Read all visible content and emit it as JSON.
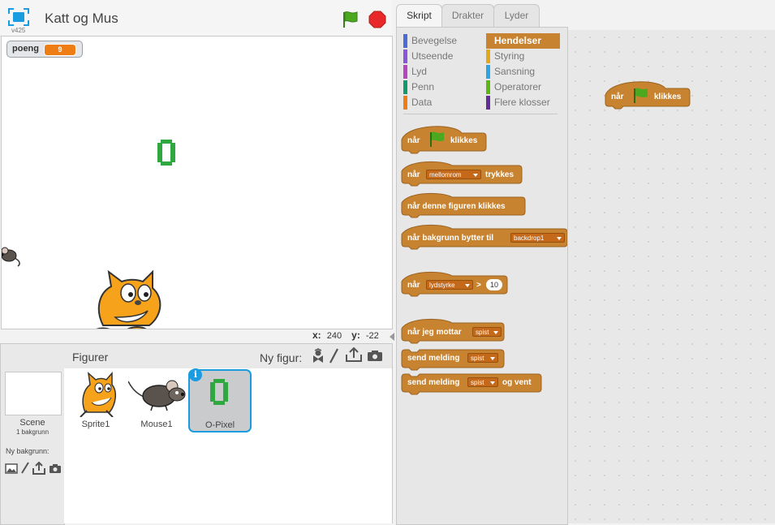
{
  "stage": {
    "version": "v425",
    "title": "Katt og Mus",
    "variable_monitor": {
      "name": "poeng",
      "value": "9"
    },
    "x_label": "x:",
    "x_value": "240",
    "y_label": "y:",
    "y_value": "-22"
  },
  "sprites_pane": {
    "scene_label": "Scene",
    "scene_backdrops": "1 bakgrunn",
    "new_backdrop_label": "Ny bakgrunn:",
    "title": "Figurer",
    "new_sprite_label": "Ny figur:",
    "sprites": [
      {
        "name": "Sprite1"
      },
      {
        "name": "Mouse1"
      },
      {
        "name": "O-Pixel",
        "selected": true
      }
    ],
    "info_badge": "i"
  },
  "tabs": [
    {
      "label": "Skript",
      "active": true
    },
    {
      "label": "Drakter",
      "active": false
    },
    {
      "label": "Lyder",
      "active": false
    }
  ],
  "palette": {
    "categories": [
      {
        "label": "Bevegelse",
        "color": "#4a6cd4"
      },
      {
        "label": "Hendelser",
        "color": "#c88330",
        "active": true
      },
      {
        "label": "Utseende",
        "color": "#8a55d7"
      },
      {
        "label": "Styring",
        "color": "#e1a91a"
      },
      {
        "label": "Lyd",
        "color": "#bb42c3"
      },
      {
        "label": "Sansning",
        "color": "#2ca5e2"
      },
      {
        "label": "Penn",
        "color": "#0e9a6c"
      },
      {
        "label": "Operatorer",
        "color": "#5cb712"
      },
      {
        "label": "Data",
        "color": "#ee7d16"
      },
      {
        "label": "Flere klosser",
        "color": "#632d99"
      }
    ],
    "blocks": {
      "b1": {
        "prefix": "når",
        "suffix": "klikkes"
      },
      "b2": {
        "prefix": "når",
        "dropdown": "mellomrom",
        "suffix": "trykkes"
      },
      "b3": {
        "text": "når denne figuren klikkes"
      },
      "b4": {
        "prefix": "når bakgrunn bytter til",
        "dropdown": "backdrop1"
      },
      "b5": {
        "prefix": "når",
        "dropdown": "lydstyrke",
        "op": ">",
        "value": "10"
      },
      "b6": {
        "prefix": "når jeg mottar",
        "dropdown": "spist"
      },
      "b7": {
        "prefix": "send melding",
        "dropdown": "spist"
      },
      "b8": {
        "prefix": "send melding",
        "dropdown": "spist",
        "suffix": "og vent"
      }
    }
  },
  "script": {
    "hat": {
      "prefix": "når",
      "suffix": "klikkes"
    }
  },
  "colors": {
    "events": "#c88330",
    "accent_blue": "#1a9ce0",
    "data": "#ee7d16"
  }
}
